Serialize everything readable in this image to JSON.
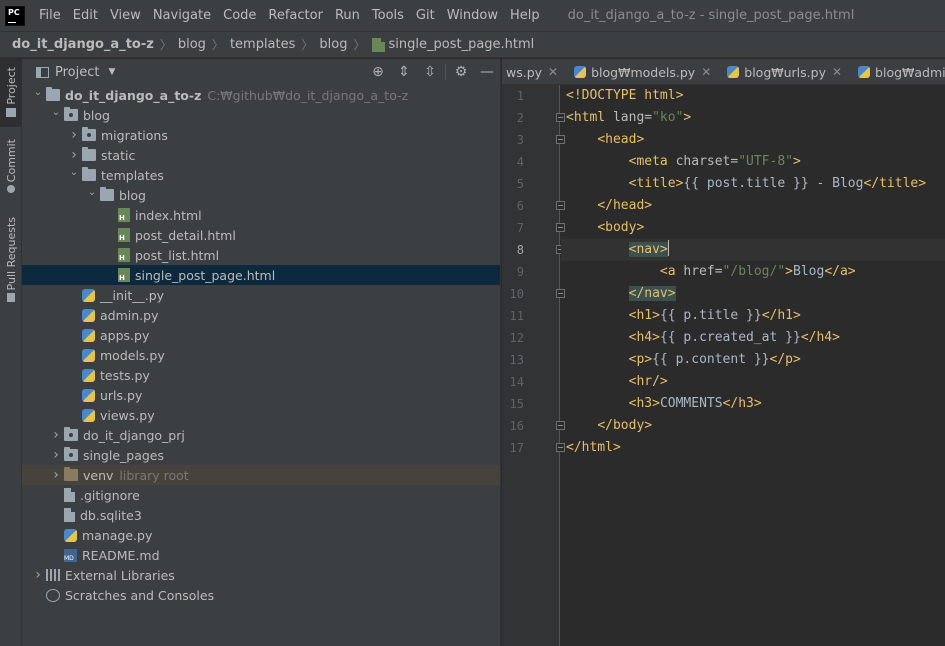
{
  "menubar": {
    "logo": "PC",
    "items": [
      "File",
      "Edit",
      "View",
      "Navigate",
      "Code",
      "Refactor",
      "Run",
      "Tools",
      "Git",
      "Window",
      "Help"
    ],
    "window_title": "do_it_django_a_to-z - single_post_page.html"
  },
  "breadcrumb": {
    "items": [
      "do_it_django_a_to-z",
      "blog",
      "templates",
      "blog",
      "single_post_page.html"
    ]
  },
  "toolstrip": {
    "tabs": [
      "Project",
      "Commit",
      "Pull Requests"
    ]
  },
  "project_panel": {
    "title": "Project",
    "tree": [
      {
        "label": "do_it_django_a_to-z",
        "hint": "C:₩github₩do_it_django_a_to-z",
        "icon": "folder",
        "expanded": true,
        "level": 0,
        "bold": true
      },
      {
        "label": "blog",
        "icon": "package",
        "expanded": true,
        "level": 1
      },
      {
        "label": "migrations",
        "icon": "package",
        "expanded": false,
        "level": 2
      },
      {
        "label": "static",
        "icon": "folder",
        "expanded": false,
        "level": 2
      },
      {
        "label": "templates",
        "icon": "folder",
        "expanded": true,
        "level": 2
      },
      {
        "label": "blog",
        "icon": "folder",
        "expanded": true,
        "level": 3
      },
      {
        "label": "index.html",
        "icon": "html",
        "level": 4
      },
      {
        "label": "post_detail.html",
        "icon": "html",
        "level": 4
      },
      {
        "label": "post_list.html",
        "icon": "html",
        "level": 4
      },
      {
        "label": "single_post_page.html",
        "icon": "html",
        "level": 4,
        "selected": true
      },
      {
        "label": "__init__.py",
        "icon": "python",
        "level": 2
      },
      {
        "label": "admin.py",
        "icon": "python",
        "level": 2
      },
      {
        "label": "apps.py",
        "icon": "python",
        "level": 2
      },
      {
        "label": "models.py",
        "icon": "python",
        "level": 2
      },
      {
        "label": "tests.py",
        "icon": "python",
        "level": 2
      },
      {
        "label": "urls.py",
        "icon": "python",
        "level": 2
      },
      {
        "label": "views.py",
        "icon": "python",
        "level": 2
      },
      {
        "label": "do_it_django_prj",
        "icon": "package",
        "expanded": false,
        "level": 1
      },
      {
        "label": "single_pages",
        "icon": "package",
        "expanded": false,
        "level": 1
      },
      {
        "label": "venv",
        "hint": "library root",
        "icon": "folder-excluded",
        "expanded": false,
        "level": 1,
        "library": true
      },
      {
        "label": ".gitignore",
        "icon": "file",
        "level": 1
      },
      {
        "label": "db.sqlite3",
        "icon": "file",
        "level": 1
      },
      {
        "label": "manage.py",
        "icon": "python",
        "level": 1
      },
      {
        "label": "README.md",
        "icon": "markdown",
        "level": 1
      },
      {
        "label": "External Libraries",
        "icon": "library",
        "expanded": false,
        "level": 0
      },
      {
        "label": "Scratches and Consoles",
        "icon": "scratch",
        "level": 0
      }
    ]
  },
  "tabs": [
    {
      "label": "ws.py"
    },
    {
      "label": "blog₩models.py"
    },
    {
      "label": "blog₩urls.py"
    },
    {
      "label": "blog₩admin.py"
    }
  ],
  "editor": {
    "current_line": 8,
    "lines": [
      [
        [
          "tag",
          "<!DOCTYPE html>"
        ]
      ],
      [
        [
          "tag",
          "<html "
        ],
        [
          "attr",
          "lang="
        ],
        [
          "str",
          "\"ko\""
        ],
        [
          "tag",
          ">"
        ]
      ],
      [
        [
          "txt",
          "    "
        ],
        [
          "tag",
          "<head>"
        ]
      ],
      [
        [
          "txt",
          "        "
        ],
        [
          "tag",
          "<meta "
        ],
        [
          "attr",
          "charset="
        ],
        [
          "str",
          "\"UTF-8\""
        ],
        [
          "tag",
          ">"
        ]
      ],
      [
        [
          "txt",
          "        "
        ],
        [
          "tag",
          "<title>"
        ],
        [
          "txt",
          "{{ post.title }} - Blog"
        ],
        [
          "tag",
          "</title>"
        ]
      ],
      [
        [
          "txt",
          "    "
        ],
        [
          "tag",
          "</head>"
        ]
      ],
      [
        [
          "txt",
          "    "
        ],
        [
          "tag",
          "<body>"
        ]
      ],
      [
        [
          "txt",
          "        "
        ],
        [
          "hltag",
          "<nav>"
        ],
        [
          "cursor",
          ""
        ]
      ],
      [
        [
          "txt",
          "            "
        ],
        [
          "tag",
          "<a "
        ],
        [
          "attr",
          "href="
        ],
        [
          "str",
          "\"/blog/\""
        ],
        [
          "tag",
          ">"
        ],
        [
          "txt",
          "Blog"
        ],
        [
          "tag",
          "</a>"
        ]
      ],
      [
        [
          "txt",
          "        "
        ],
        [
          "hltag",
          "</nav>"
        ]
      ],
      [
        [
          "txt",
          "        "
        ],
        [
          "tag",
          "<h1>"
        ],
        [
          "txt",
          "{{ p.title }}"
        ],
        [
          "tag",
          "</h1>"
        ]
      ],
      [
        [
          "txt",
          "        "
        ],
        [
          "tag",
          "<h4>"
        ],
        [
          "txt",
          "{{ p.created_at }}"
        ],
        [
          "tag",
          "</h4>"
        ]
      ],
      [
        [
          "txt",
          "        "
        ],
        [
          "tag",
          "<p>"
        ],
        [
          "txt",
          "{{ p.content }}"
        ],
        [
          "tag",
          "</p>"
        ]
      ],
      [
        [
          "txt",
          "        "
        ],
        [
          "tag",
          "<hr/>"
        ]
      ],
      [
        [
          "txt",
          "        "
        ],
        [
          "tag",
          "<h3>"
        ],
        [
          "txt",
          "COMMENTS"
        ],
        [
          "tag",
          "</h3>"
        ]
      ],
      [
        [
          "txt",
          "    "
        ],
        [
          "tag",
          "</body>"
        ]
      ],
      [
        [
          "tag",
          "</html>"
        ]
      ]
    ]
  },
  "colors": {
    "tag": "#e8bf6a",
    "attr": "#bababa",
    "string": "#6a8759",
    "text": "#a9b7c6",
    "selection": "#0d293e"
  }
}
